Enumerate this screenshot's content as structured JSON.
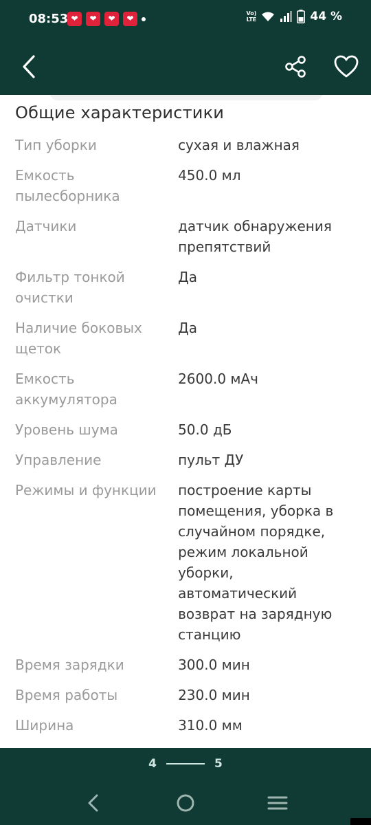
{
  "status_bar": {
    "time": "08:53",
    "notification_icons": [
      "heart-badge-icon",
      "heart-badge-icon",
      "heart-badge-icon",
      "heart-badge-icon"
    ],
    "volte_line1": "Vo)",
    "volte_line2": "LTE",
    "battery_percent": "44 %"
  },
  "app_bar": {
    "icons": [
      "back-arrow-icon",
      "share-icon",
      "heart-outline-icon"
    ]
  },
  "section": {
    "title": "Общие характеристики"
  },
  "specs": [
    {
      "label": "Тип уборки",
      "value": "сухая и влажная"
    },
    {
      "label": "Емкость пылесборника",
      "value": "450.0 мл"
    },
    {
      "label": "Датчики",
      "value": "датчик обнаружения препятствий"
    },
    {
      "label": "Фильтр тонкой очистки",
      "value": "Да"
    },
    {
      "label": "Наличие боковых щеток",
      "value": "Да"
    },
    {
      "label": "Емкость аккумулятора",
      "value": "2600.0 мАч"
    },
    {
      "label": "Уровень шума",
      "value": "50.0 дБ"
    },
    {
      "label": "Управление",
      "value": "пульт ДУ"
    },
    {
      "label": "Режимы и функции",
      "value": "построение карты помещения, уборка в случайном порядке, режим локальной уборки, автоматический возврат на зарядную станцию"
    },
    {
      "label": "Время зарядки",
      "value": "300.0 мин"
    },
    {
      "label": "Время работы",
      "value": "230.0 мин"
    },
    {
      "label": "Ширина",
      "value": "310.0 мм"
    }
  ],
  "pager": {
    "current": "4",
    "next": "5"
  },
  "colors": {
    "primary_dark": "#0f3b34",
    "notification_badge": "#e0223a",
    "label_gray": "#9a9a9a",
    "value_dark": "#3a3a3a"
  }
}
